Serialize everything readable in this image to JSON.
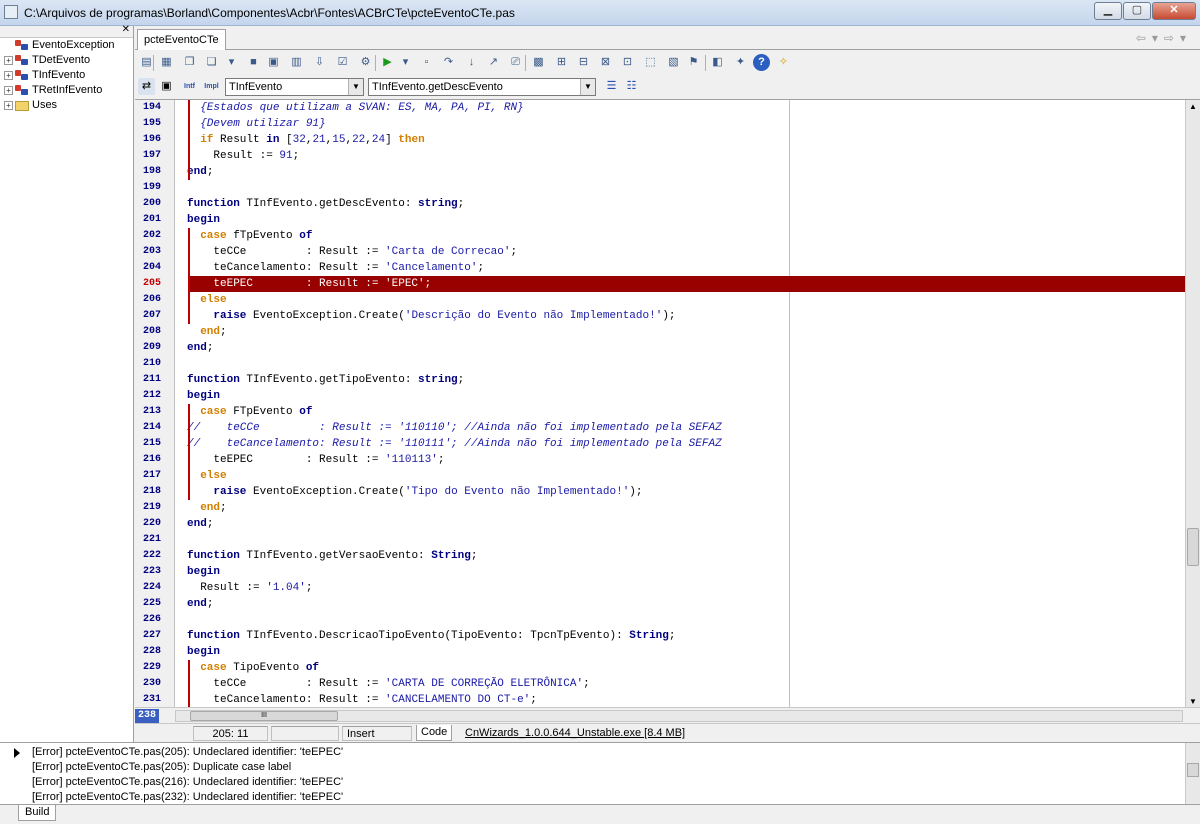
{
  "window": {
    "title": "C:\\Arquivos de programas\\Borland\\Componentes\\Acbr\\Fontes\\ACBrCTe\\pcteEventoCTe.pas"
  },
  "tree": {
    "items": [
      {
        "label": "EventoException",
        "expandable": false,
        "icon": "class-icon"
      },
      {
        "label": "TDetEvento",
        "expandable": true,
        "icon": "class-icon"
      },
      {
        "label": "TInfEvento",
        "expandable": true,
        "icon": "class-icon"
      },
      {
        "label": "TRetInfEvento",
        "expandable": true,
        "icon": "class-icon"
      },
      {
        "label": "Uses",
        "expandable": true,
        "icon": "folder-icon"
      }
    ]
  },
  "editor": {
    "tab_label": "pcteEventoCTe",
    "class_combo": "TInfEvento",
    "method_combo": "TInfEvento.getDescEvento",
    "current_line_box": "238",
    "hscroll_thumb": "III",
    "highlight_color": "#990000"
  },
  "code": {
    "lines": [
      {
        "n": "194",
        "html": "  <span class='cmt'>{Estados que utilizam a SVAN: ES, MA, PA, PI, RN}</span>"
      },
      {
        "n": "195",
        "html": "  <span class='cmt'>{Devem utilizar 91}</span>"
      },
      {
        "n": "196",
        "html": "  <span class='kw2'>if</span> Result <span class='kw'>in</span> [<span class='num'>32</span>,<span class='num'>21</span>,<span class='num'>15</span>,<span class='num'>22</span>,<span class='num'>24</span>] <span class='kw2'>then</span>"
      },
      {
        "n": "197",
        "html": "    Result := <span class='num'>91</span>;"
      },
      {
        "n": "198",
        "html": "<span class='kw'>end</span>;"
      },
      {
        "n": "199",
        "html": ""
      },
      {
        "n": "200",
        "html": "<span class='kw'>function</span> TInfEvento.getDescEvento: <span class='kw'>string</span>;"
      },
      {
        "n": "201",
        "html": "<span class='kw'>begin</span>"
      },
      {
        "n": "202",
        "html": "  <span class='kw2'>case</span> fTpEvento <span class='kw'>of</span>"
      },
      {
        "n": "203",
        "html": "    teCCe         : Result := <span class='str'>'Carta de Correcao'</span>;"
      },
      {
        "n": "204",
        "html": "    teCancelamento: Result := <span class='str'>'Cancelamento'</span>;"
      },
      {
        "n": "205",
        "html": "    teEPEC        : Result := 'EPEC';",
        "highlight": true
      },
      {
        "n": "206",
        "html": "  <span class='kw2'>else</span>"
      },
      {
        "n": "207",
        "html": "    <span class='kw'>raise</span> EventoException.Create(<span class='str'>'Descrição do Evento não Implementado!'</span>);"
      },
      {
        "n": "208",
        "html": "  <span class='kw2'>end</span>;"
      },
      {
        "n": "209",
        "html": "<span class='kw'>end</span>;"
      },
      {
        "n": "210",
        "html": ""
      },
      {
        "n": "211",
        "html": "<span class='kw'>function</span> TInfEvento.getTipoEvento: <span class='kw'>string</span>;"
      },
      {
        "n": "212",
        "html": "<span class='kw'>begin</span>"
      },
      {
        "n": "213",
        "html": "  <span class='kw2'>case</span> FTpEvento <span class='kw'>of</span>"
      },
      {
        "n": "214",
        "html": "<span class='cmt'>//    teCCe         : Result := '110110'; //Ainda não foi implementado pela SEFAZ</span>"
      },
      {
        "n": "215",
        "html": "<span class='cmt'>//    teCancelamento: Result := '110111'; //Ainda não foi implementado pela SEFAZ</span>"
      },
      {
        "n": "216",
        "html": "    teEPEC        : Result := <span class='str'>'110113'</span>;"
      },
      {
        "n": "217",
        "html": "  <span class='kw2'>else</span>"
      },
      {
        "n": "218",
        "html": "    <span class='kw'>raise</span> EventoException.Create(<span class='str'>'Tipo do Evento não Implementado!'</span>);"
      },
      {
        "n": "219",
        "html": "  <span class='kw2'>end</span>;"
      },
      {
        "n": "220",
        "html": "<span class='kw'>end</span>;"
      },
      {
        "n": "221",
        "html": ""
      },
      {
        "n": "222",
        "html": "<span class='kw'>function</span> TInfEvento.getVersaoEvento: <span class='kw'>String</span>;"
      },
      {
        "n": "223",
        "html": "<span class='kw'>begin</span>"
      },
      {
        "n": "224",
        "html": "  Result := <span class='str'>'1.04'</span>;"
      },
      {
        "n": "225",
        "html": "<span class='kw'>end</span>;"
      },
      {
        "n": "226",
        "html": ""
      },
      {
        "n": "227",
        "html": "<span class='kw'>function</span> TInfEvento.DescricaoTipoEvento(TipoEvento: TpcnTpEvento): <span class='kw'>String</span>;"
      },
      {
        "n": "228",
        "html": "<span class='kw'>begin</span>"
      },
      {
        "n": "229",
        "html": "  <span class='kw2'>case</span> TipoEvento <span class='kw'>of</span>"
      },
      {
        "n": "230",
        "html": "    teCCe         : Result := <span class='str'>'CARTA DE CORREÇÃO ELETRÔNICA'</span>;"
      },
      {
        "n": "231",
        "html": "    teCancelamento: Result := <span class='str'>'CANCELAMENTO DO CT-e'</span>;"
      }
    ]
  },
  "status": {
    "position": "205: 11",
    "mode": "Insert",
    "code_tab": "Code",
    "process": "CnWizards_1.0.0.644_Unstable.exe [8.4 MB]"
  },
  "messages": {
    "items": [
      "[Error] pcteEventoCTe.pas(205): Undeclared identifier: 'teEPEC'",
      "[Error] pcteEventoCTe.pas(205): Duplicate case label",
      "[Error] pcteEventoCTe.pas(216): Undeclared identifier: 'teEPEC'",
      "[Error] pcteEventoCTe.pas(232): Undeclared identifier: 'teEPEC'"
    ],
    "tab_label": "Build"
  },
  "icons": {
    "minimize": "minimize-icon",
    "maximize": "maximize-icon",
    "close": "close-icon"
  }
}
